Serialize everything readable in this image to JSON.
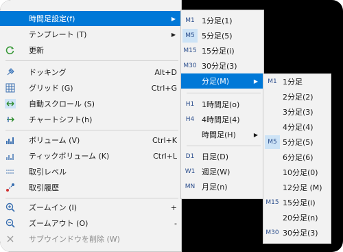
{
  "main_menu": {
    "timeframe": "時間足設定(f)",
    "template": "テンプレート (T)",
    "refresh": "更新",
    "docking": "ドッキング",
    "docking_sc": "Alt+D",
    "grid": "グリッド (G)",
    "grid_sc": "Ctrl+G",
    "autoscroll": "自動スクロール (S)",
    "chartshift": "チャートシフト(h)",
    "volume": "ボリューム (V)",
    "volume_sc": "Ctrl+K",
    "tickvolume": "ティックボリューム (K)",
    "tickvolume_sc": "Ctrl+L",
    "tradelevel": "取引レベル",
    "tradehistory": "取引履歴",
    "zoomin": "ズームイン (I)",
    "zoomin_sc": "+",
    "zoomout": "ズームアウト (O)",
    "zoomout_sc": "-",
    "delsub": "サブウインドウを削除 (W)"
  },
  "sub1": {
    "items": [
      {
        "code": "M1",
        "label": "1分足(1)"
      },
      {
        "code": "M5",
        "label": "5分足(5)"
      },
      {
        "code": "M15",
        "label": "15分足(i)"
      },
      {
        "code": "M30",
        "label": "30分足(3)"
      },
      {
        "code": "",
        "label": "分足(M)"
      },
      {
        "code": "H1",
        "label": "1時間足(o)"
      },
      {
        "code": "H4",
        "label": "4時間足(4)"
      },
      {
        "code": "",
        "label": "時間足(H)"
      },
      {
        "code": "D1",
        "label": "日足(D)"
      },
      {
        "code": "W1",
        "label": "週足(W)"
      },
      {
        "code": "MN",
        "label": "月足(n)"
      }
    ]
  },
  "sub2": {
    "items": [
      {
        "code": "M1",
        "label": "1分足"
      },
      {
        "code": "",
        "label": "2分足(2)"
      },
      {
        "code": "",
        "label": "3分足(3)"
      },
      {
        "code": "",
        "label": "4分足(4)"
      },
      {
        "code": "M5",
        "label": "5分足(5)"
      },
      {
        "code": "",
        "label": "6分足(6)"
      },
      {
        "code": "",
        "label": "10分足(0)"
      },
      {
        "code": "",
        "label": "12分足 (M)"
      },
      {
        "code": "M15",
        "label": "15分足(i)"
      },
      {
        "code": "",
        "label": "20分足(n)"
      },
      {
        "code": "M30",
        "label": "30分足(3)"
      }
    ]
  },
  "colors": {
    "highlight": "#0078d7",
    "menu_bg": "#f2f2f2",
    "selected_tf_bg": "#cde3f6"
  }
}
